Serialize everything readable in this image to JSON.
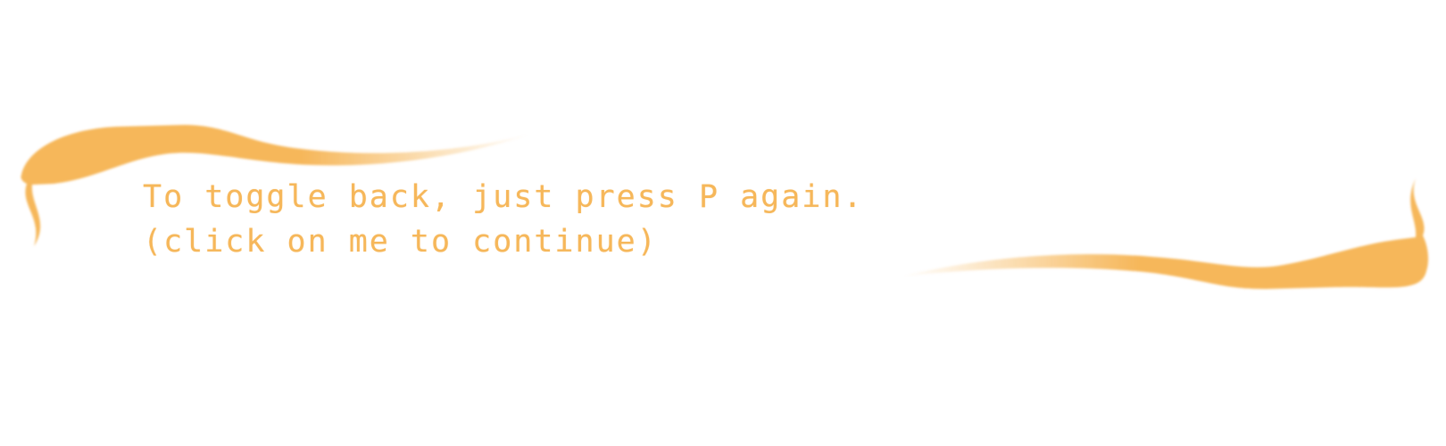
{
  "dialog": {
    "message": "To toggle back, just press P again.",
    "continue_hint": "(click on me to continue)"
  },
  "colors": {
    "accent": "#f6b75a",
    "background": "#ffffff"
  },
  "decorations": {
    "left": "brush-swoosh",
    "right": "brush-swoosh"
  }
}
